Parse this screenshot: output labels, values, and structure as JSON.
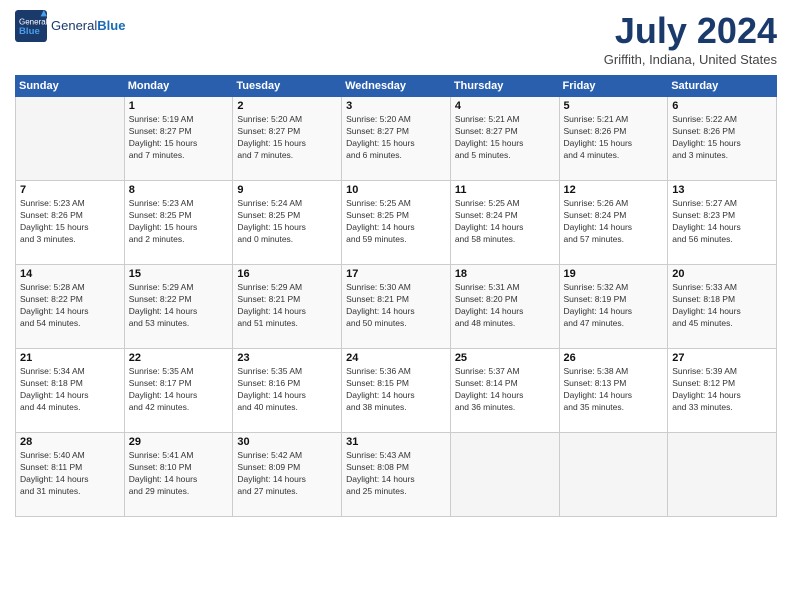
{
  "header": {
    "logo_general": "General",
    "logo_blue": "Blue",
    "month_title": "July 2024",
    "location": "Griffith, Indiana, United States"
  },
  "weekdays": [
    "Sunday",
    "Monday",
    "Tuesday",
    "Wednesday",
    "Thursday",
    "Friday",
    "Saturday"
  ],
  "weeks": [
    [
      {
        "day": "",
        "info": ""
      },
      {
        "day": "1",
        "info": "Sunrise: 5:19 AM\nSunset: 8:27 PM\nDaylight: 15 hours\nand 7 minutes."
      },
      {
        "day": "2",
        "info": "Sunrise: 5:20 AM\nSunset: 8:27 PM\nDaylight: 15 hours\nand 7 minutes."
      },
      {
        "day": "3",
        "info": "Sunrise: 5:20 AM\nSunset: 8:27 PM\nDaylight: 15 hours\nand 6 minutes."
      },
      {
        "day": "4",
        "info": "Sunrise: 5:21 AM\nSunset: 8:27 PM\nDaylight: 15 hours\nand 5 minutes."
      },
      {
        "day": "5",
        "info": "Sunrise: 5:21 AM\nSunset: 8:26 PM\nDaylight: 15 hours\nand 4 minutes."
      },
      {
        "day": "6",
        "info": "Sunrise: 5:22 AM\nSunset: 8:26 PM\nDaylight: 15 hours\nand 3 minutes."
      }
    ],
    [
      {
        "day": "7",
        "info": "Sunrise: 5:23 AM\nSunset: 8:26 PM\nDaylight: 15 hours\nand 3 minutes."
      },
      {
        "day": "8",
        "info": "Sunrise: 5:23 AM\nSunset: 8:25 PM\nDaylight: 15 hours\nand 2 minutes."
      },
      {
        "day": "9",
        "info": "Sunrise: 5:24 AM\nSunset: 8:25 PM\nDaylight: 15 hours\nand 0 minutes."
      },
      {
        "day": "10",
        "info": "Sunrise: 5:25 AM\nSunset: 8:25 PM\nDaylight: 14 hours\nand 59 minutes."
      },
      {
        "day": "11",
        "info": "Sunrise: 5:25 AM\nSunset: 8:24 PM\nDaylight: 14 hours\nand 58 minutes."
      },
      {
        "day": "12",
        "info": "Sunrise: 5:26 AM\nSunset: 8:24 PM\nDaylight: 14 hours\nand 57 minutes."
      },
      {
        "day": "13",
        "info": "Sunrise: 5:27 AM\nSunset: 8:23 PM\nDaylight: 14 hours\nand 56 minutes."
      }
    ],
    [
      {
        "day": "14",
        "info": "Sunrise: 5:28 AM\nSunset: 8:22 PM\nDaylight: 14 hours\nand 54 minutes."
      },
      {
        "day": "15",
        "info": "Sunrise: 5:29 AM\nSunset: 8:22 PM\nDaylight: 14 hours\nand 53 minutes."
      },
      {
        "day": "16",
        "info": "Sunrise: 5:29 AM\nSunset: 8:21 PM\nDaylight: 14 hours\nand 51 minutes."
      },
      {
        "day": "17",
        "info": "Sunrise: 5:30 AM\nSunset: 8:21 PM\nDaylight: 14 hours\nand 50 minutes."
      },
      {
        "day": "18",
        "info": "Sunrise: 5:31 AM\nSunset: 8:20 PM\nDaylight: 14 hours\nand 48 minutes."
      },
      {
        "day": "19",
        "info": "Sunrise: 5:32 AM\nSunset: 8:19 PM\nDaylight: 14 hours\nand 47 minutes."
      },
      {
        "day": "20",
        "info": "Sunrise: 5:33 AM\nSunset: 8:18 PM\nDaylight: 14 hours\nand 45 minutes."
      }
    ],
    [
      {
        "day": "21",
        "info": "Sunrise: 5:34 AM\nSunset: 8:18 PM\nDaylight: 14 hours\nand 44 minutes."
      },
      {
        "day": "22",
        "info": "Sunrise: 5:35 AM\nSunset: 8:17 PM\nDaylight: 14 hours\nand 42 minutes."
      },
      {
        "day": "23",
        "info": "Sunrise: 5:35 AM\nSunset: 8:16 PM\nDaylight: 14 hours\nand 40 minutes."
      },
      {
        "day": "24",
        "info": "Sunrise: 5:36 AM\nSunset: 8:15 PM\nDaylight: 14 hours\nand 38 minutes."
      },
      {
        "day": "25",
        "info": "Sunrise: 5:37 AM\nSunset: 8:14 PM\nDaylight: 14 hours\nand 36 minutes."
      },
      {
        "day": "26",
        "info": "Sunrise: 5:38 AM\nSunset: 8:13 PM\nDaylight: 14 hours\nand 35 minutes."
      },
      {
        "day": "27",
        "info": "Sunrise: 5:39 AM\nSunset: 8:12 PM\nDaylight: 14 hours\nand 33 minutes."
      }
    ],
    [
      {
        "day": "28",
        "info": "Sunrise: 5:40 AM\nSunset: 8:11 PM\nDaylight: 14 hours\nand 31 minutes."
      },
      {
        "day": "29",
        "info": "Sunrise: 5:41 AM\nSunset: 8:10 PM\nDaylight: 14 hours\nand 29 minutes."
      },
      {
        "day": "30",
        "info": "Sunrise: 5:42 AM\nSunset: 8:09 PM\nDaylight: 14 hours\nand 27 minutes."
      },
      {
        "day": "31",
        "info": "Sunrise: 5:43 AM\nSunset: 8:08 PM\nDaylight: 14 hours\nand 25 minutes."
      },
      {
        "day": "",
        "info": ""
      },
      {
        "day": "",
        "info": ""
      },
      {
        "day": "",
        "info": ""
      }
    ]
  ]
}
